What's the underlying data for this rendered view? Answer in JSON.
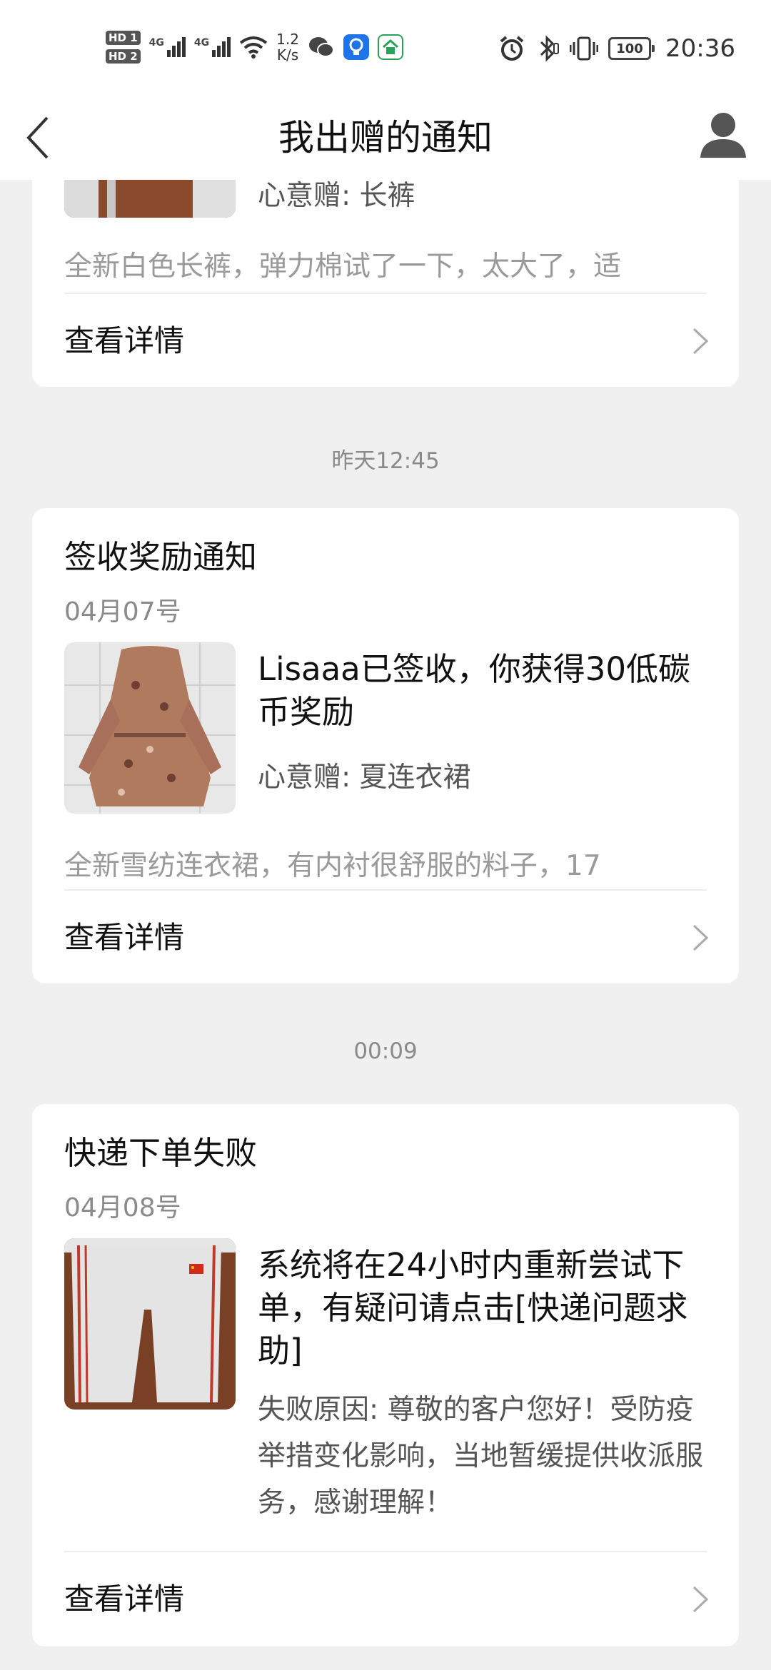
{
  "status_bar": {
    "hd1": "HD 1",
    "hd2": "HD 2",
    "net1": "4G",
    "net2": "4G",
    "speed_value": "1.2",
    "speed_unit": "K/s",
    "battery": "100",
    "time": "20:36"
  },
  "header": {
    "title": "我出赠的通知"
  },
  "cards": [
    {
      "main_text": "",
      "sub_text": "心意赠: 长裤",
      "preview": "全新白色长裤，弹力棉试了一下，太大了，适",
      "details_label": "查看详情"
    },
    {
      "timestamp": "昨天12:45",
      "title": "签收奖励通知",
      "date": "04月07号",
      "main_text": "Lisaaa已签收，你获得30低碳币奖励",
      "sub_text": "心意赠: 夏连衣裙",
      "preview": "全新雪纺连衣裙，有内衬很舒服的料子，17",
      "details_label": "查看详情"
    },
    {
      "timestamp": "00:09",
      "title": "快递下单失败",
      "date": "04月08号",
      "main_text": "系统将在24小时内重新尝试下单，有疑问请点击[快递问题求助]",
      "sub_text": "失败原因: 尊敬的客户您好！受防疫举措变化影响，当地暂缓提供收派服务，感谢理解！",
      "details_label": "查看详情"
    }
  ],
  "colors": {
    "background": "#f0f0f0",
    "card": "#ffffff",
    "primary_text": "#111111",
    "secondary_text": "#8a8a8a"
  },
  "icons": [
    "back-arrow-icon",
    "user-profile-icon",
    "chevron-right-icon",
    "wechat-icon",
    "alarm-icon",
    "bluetooth-icon",
    "vibrate-icon",
    "wifi-icon"
  ]
}
